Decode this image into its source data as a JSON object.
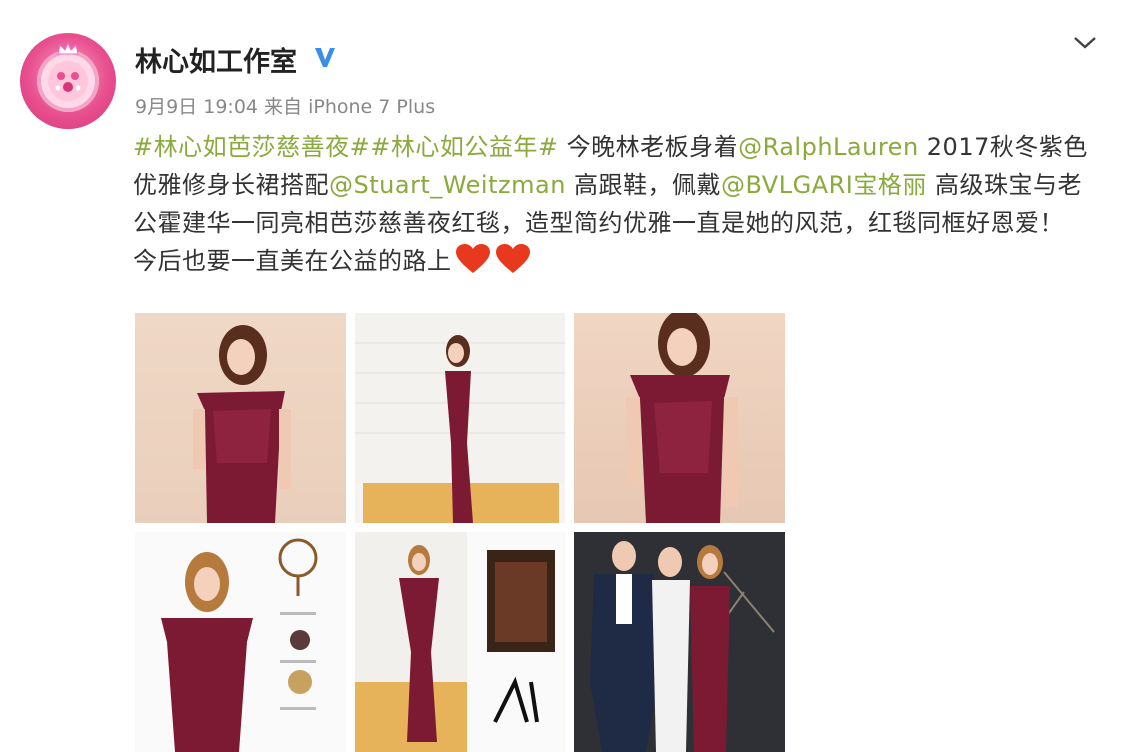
{
  "post": {
    "username": "林心如工作室",
    "date": "9月9日",
    "time": "19:04",
    "source_prefix": "来自",
    "source_device": "iPhone 7 Plus",
    "content": {
      "hashtag1": "#林心如芭莎慈善夜#",
      "hashtag2": "#林心如公益年#",
      "text1": " 今晚林老板身着",
      "mention1": "@RalphLauren",
      "text2": " 2017秋冬紫色优雅修身长裙搭配",
      "mention2": "@Stuart_Weitzman",
      "text3": " 高跟鞋，佩戴",
      "mention3": "@BVLGARI宝格丽",
      "text4": " 高级珠宝与老公霍建华一同亮相芭莎慈善夜红毯，造型简约优雅一直是她的风范，红毯同框好恩爱！今后也要一直美在公益的路上"
    },
    "photo_count": 6
  },
  "colors": {
    "link": "#8aaa3c",
    "text": "#333333",
    "meta": "#888888",
    "verified": "#3a8ee6",
    "dress": "#7d1a33",
    "heart": "#e8391e"
  },
  "icons": {
    "verified": "verified-v-icon",
    "dropdown": "chevron-down-icon",
    "emoji": "red-heart-emoji"
  }
}
